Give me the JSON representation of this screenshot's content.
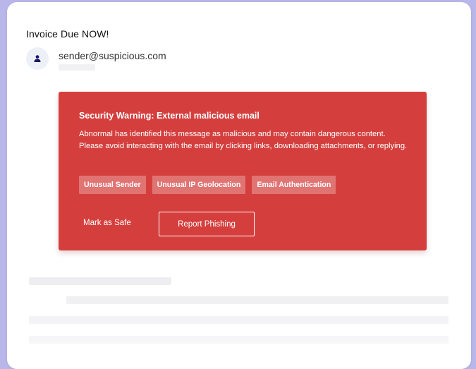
{
  "email": {
    "subject": "Invoice Due NOW!",
    "sender": "sender@suspicious.com",
    "avatar_icon": "user-icon"
  },
  "warning_banner": {
    "title": "Security Warning: External malicious email",
    "message": "Abnormal has identified this message as malicious and may contain dangerous content. Please avoid interacting with the email by clicking links, downloading attachments, or replying.",
    "tags": [
      "Unusual Sender",
      "Unusual IP Geolocation",
      "Email Authentication"
    ],
    "mark_safe_label": "Mark as Safe",
    "report_label": "Report Phishing",
    "color": "#d43f3e"
  },
  "colors": {
    "background": "#b9b6ea",
    "avatar_icon": "#1a1766"
  }
}
